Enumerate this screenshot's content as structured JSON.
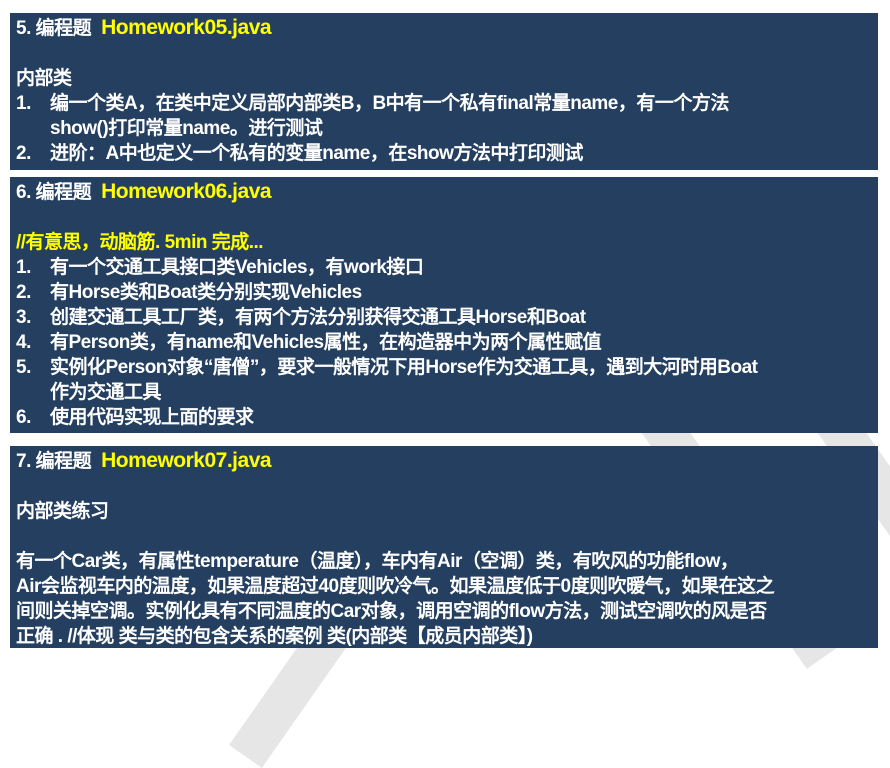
{
  "colors": {
    "box_bg": "#243f60",
    "text": "#ffffff",
    "highlight": "#ffff00"
  },
  "hw5": {
    "label": "5. 编程题",
    "file": "Homework05.java",
    "topic": "内部类",
    "items": [
      {
        "num": "1.",
        "lines": [
          "编一个类A，在类中定义局部内部类B，B中有一个私有final常量name，有一个方法",
          "show()打印常量name。进行测试"
        ]
      },
      {
        "num": "2.",
        "lines": [
          "进阶：A中也定义一个私有的变量name，在show方法中打印测试"
        ]
      }
    ]
  },
  "hw6": {
    "label": "6. 编程题",
    "file": "Homework06.java",
    "note": "//有意思，动脑筋. 5min 完成...",
    "items": [
      {
        "num": "1.",
        "lines": [
          "有一个交通工具接口类Vehicles，有work接口"
        ]
      },
      {
        "num": "2.",
        "lines": [
          "有Horse类和Boat类分别实现Vehicles"
        ]
      },
      {
        "num": "3.",
        "lines": [
          "创建交通工具工厂类，有两个方法分别获得交通工具Horse和Boat"
        ]
      },
      {
        "num": "4.",
        "lines": [
          "有Person类，有name和Vehicles属性，在构造器中为两个属性赋值"
        ]
      },
      {
        "num": "5.",
        "lines": [
          "实例化Person对象“唐僧”，要求一般情况下用Horse作为交通工具，遇到大河时用Boat",
          "作为交通工具"
        ]
      },
      {
        "num": "6.",
        "lines": [
          "使用代码实现上面的要求"
        ]
      }
    ]
  },
  "hw7": {
    "label": "7. 编程题",
    "file": "Homework07.java",
    "topic": "内部类练习",
    "lines": [
      "有一个Car类，有属性temperature（温度），车内有Air（空调）类，有吹风的功能flow，",
      "Air会监视车内的温度，如果温度超过40度则吹冷气。如果温度低于0度则吹暖气，如果在这之",
      "间则关掉空调。实例化具有不同温度的Car对象，调用空调的flow方法，测试空调吹的风是否",
      "正确 . //体现 类与类的包含关系的案例 类(内部类【成员内部类】)"
    ]
  }
}
